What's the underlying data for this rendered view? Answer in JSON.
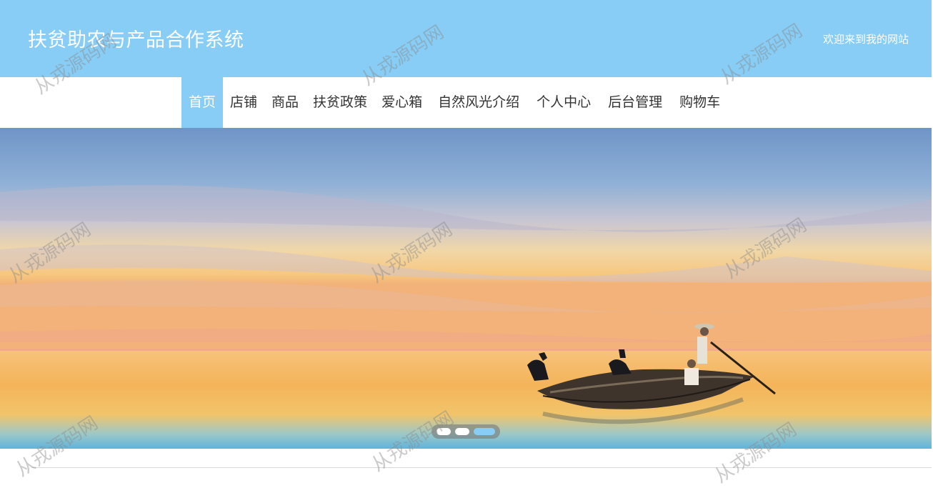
{
  "header": {
    "title": "扶贫助农与产品合作系统",
    "welcome": "欢迎来到我的网站"
  },
  "nav": {
    "items": [
      {
        "label": "首页",
        "active": true
      },
      {
        "label": "店铺"
      },
      {
        "label": "商品"
      },
      {
        "label": "扶贫政策"
      },
      {
        "label": "爱心箱"
      },
      {
        "label": "自然风光介绍"
      },
      {
        "label": "个人中心"
      },
      {
        "label": "后台管理"
      },
      {
        "label": "购物车"
      }
    ]
  },
  "carousel": {
    "slide_count": 3,
    "active_index": 3
  },
  "watermark": "从戎源码网",
  "colors": {
    "accent": "#88cdf6",
    "header_bg": "#88cdf6",
    "nav_text": "#333333"
  }
}
